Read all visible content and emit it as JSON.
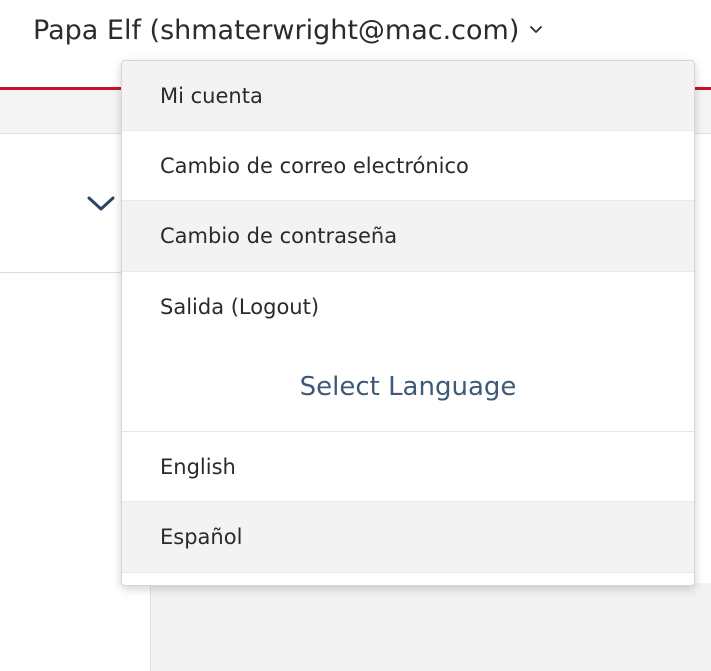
{
  "user_menu": {
    "trigger_label": "Papa Elf (shmaterwright@mac.com)",
    "caret_icon": "chevron-down-icon"
  },
  "account_items": [
    {
      "label": "Mi cuenta"
    },
    {
      "label": "Cambio de correo electrónico"
    },
    {
      "label": "Cambio de contraseña"
    },
    {
      "label": "Salida (Logout)"
    }
  ],
  "language": {
    "heading": "Select Language",
    "options": [
      {
        "label": "English"
      },
      {
        "label": "Español"
      }
    ]
  },
  "colors": {
    "accent_red": "#c8102e",
    "heading_blue": "#3e5a78",
    "chevron_navy": "#2c4466"
  }
}
